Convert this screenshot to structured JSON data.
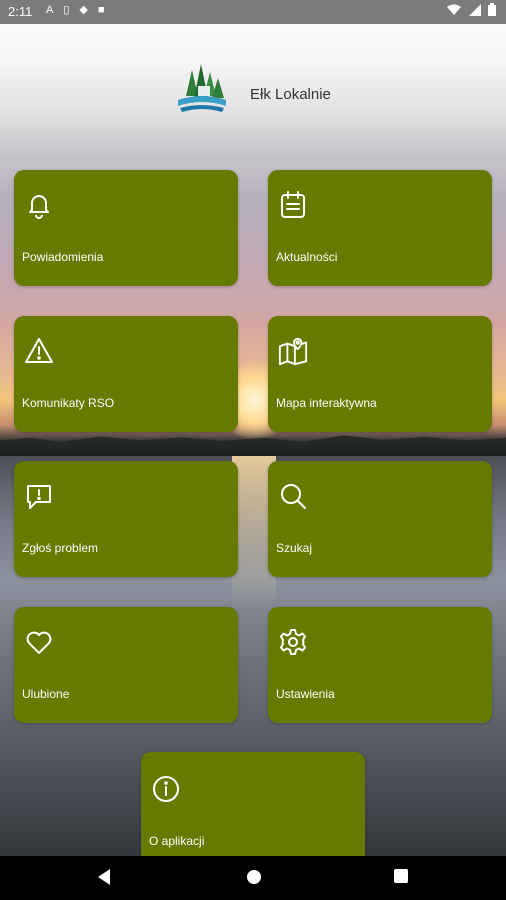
{
  "status_bar": {
    "time": "2:11",
    "left_icons": [
      "a-icon",
      "sim-icon",
      "shield-icon",
      "square-icon"
    ],
    "right_icons": [
      "wifi-icon",
      "signal-icon",
      "battery-icon"
    ]
  },
  "header": {
    "title": "Ełk Lokalnie"
  },
  "tiles": [
    {
      "label": "Powiadomienia",
      "icon": "bell-icon"
    },
    {
      "label": "Aktualności",
      "icon": "news-icon"
    },
    {
      "label": "Komunikaty RSO",
      "icon": "warning-icon"
    },
    {
      "label": "Mapa interaktywna",
      "icon": "map-icon"
    },
    {
      "label": "Zgłoś problem",
      "icon": "report-icon"
    },
    {
      "label": "Szukaj",
      "icon": "search-icon"
    },
    {
      "label": "Ulubione",
      "icon": "heart-icon"
    },
    {
      "label": "Ustawienia",
      "icon": "gear-icon"
    },
    {
      "label": "O aplikacji",
      "icon": "info-icon"
    }
  ],
  "nav": {
    "buttons": [
      "back-icon",
      "home-icon",
      "recents-icon"
    ]
  },
  "colors": {
    "tile": "#667a00",
    "status_bar": "#7b7b7b",
    "nav_bar": "#000000"
  }
}
